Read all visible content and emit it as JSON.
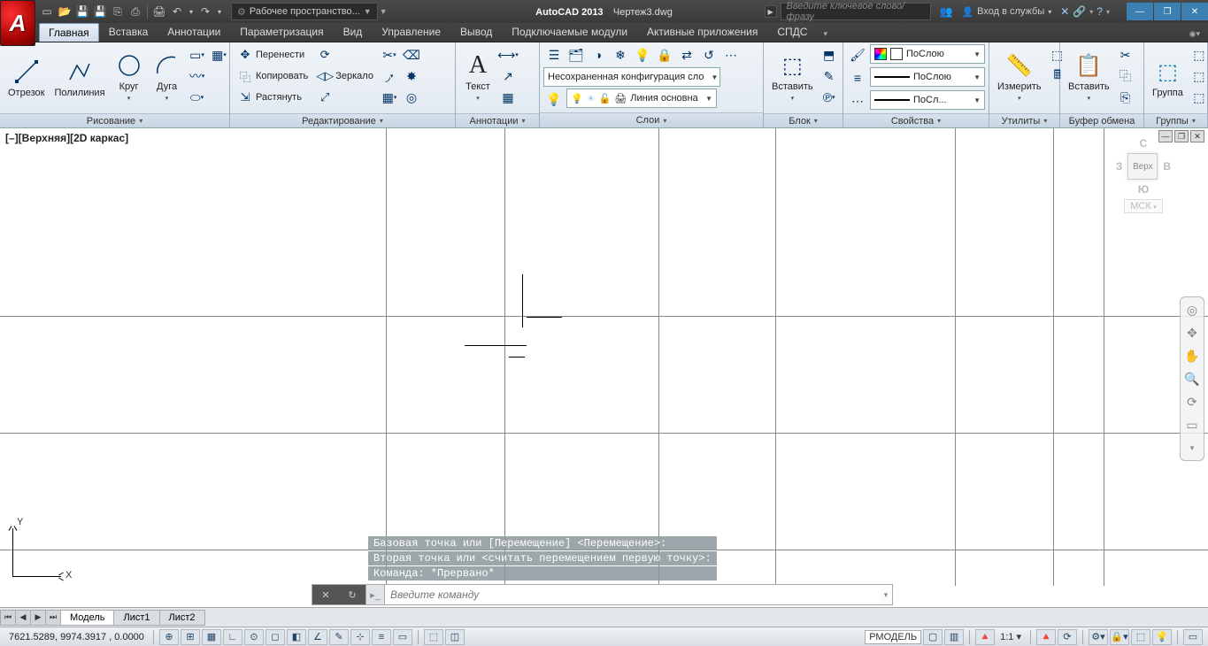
{
  "app": {
    "name": "AutoCAD 2013",
    "doc": "Чертеж3.dwg",
    "workspace": "Рабочее пространство..."
  },
  "titlebar": {
    "searchPlaceholder": "Введите ключевое слово/фразу",
    "login": "Вход в службы"
  },
  "tabs": [
    "Главная",
    "Вставка",
    "Аннотации",
    "Параметризация",
    "Вид",
    "Управление",
    "Вывод",
    "Подключаемые модули",
    "Активные приложения",
    "СПДС"
  ],
  "activeTab": 0,
  "ribbon": {
    "draw": {
      "title": "Рисование",
      "line": "Отрезок",
      "polyline": "Полилиния",
      "circle": "Круг",
      "arc": "Дуга"
    },
    "modify": {
      "title": "Редактирование",
      "move": "Перенести",
      "copy": "Копировать",
      "stretch": "Растянуть",
      "mirror": "Зеркало"
    },
    "annot": {
      "title": "Аннотации",
      "text": "Текст"
    },
    "layers": {
      "title": "Слои",
      "config": "Несохраненная конфигурация сло",
      "current": "Линия основна"
    },
    "block": {
      "title": "Блок",
      "insert": "Вставить"
    },
    "props": {
      "title": "Свойства",
      "bylayer": "ПоСлою",
      "bylayer2": "ПоСлою",
      "byl3": "ПоСл..."
    },
    "utils": {
      "title": "Утилиты",
      "measure": "Измерить"
    },
    "clip": {
      "title": "Буфер обмена",
      "paste": "Вставить"
    },
    "groups": {
      "title": "Группы",
      "group": "Группа"
    }
  },
  "viewport": {
    "label": "[–][Верхняя][2D каркас]"
  },
  "viewcube": {
    "top": "Верх",
    "n": "С",
    "e": "В",
    "s": "Ю",
    "w": "З",
    "wcs": "МСК"
  },
  "ucs": {
    "x": "X",
    "y": "Y"
  },
  "cli": {
    "hist": [
      "Базовая точка или [Перемещение] <Перемещение>:",
      "Вторая точка или <считать перемещением первую точку>:",
      "Команда: *Прервано*"
    ],
    "placeholder": "Введите команду"
  },
  "modelTabs": [
    "Модель",
    "Лист1",
    "Лист2"
  ],
  "status": {
    "coords": "7621.5289, 9974.3917 , 0.0000",
    "space": "РМОДЕЛЬ",
    "scale": "1:1"
  }
}
